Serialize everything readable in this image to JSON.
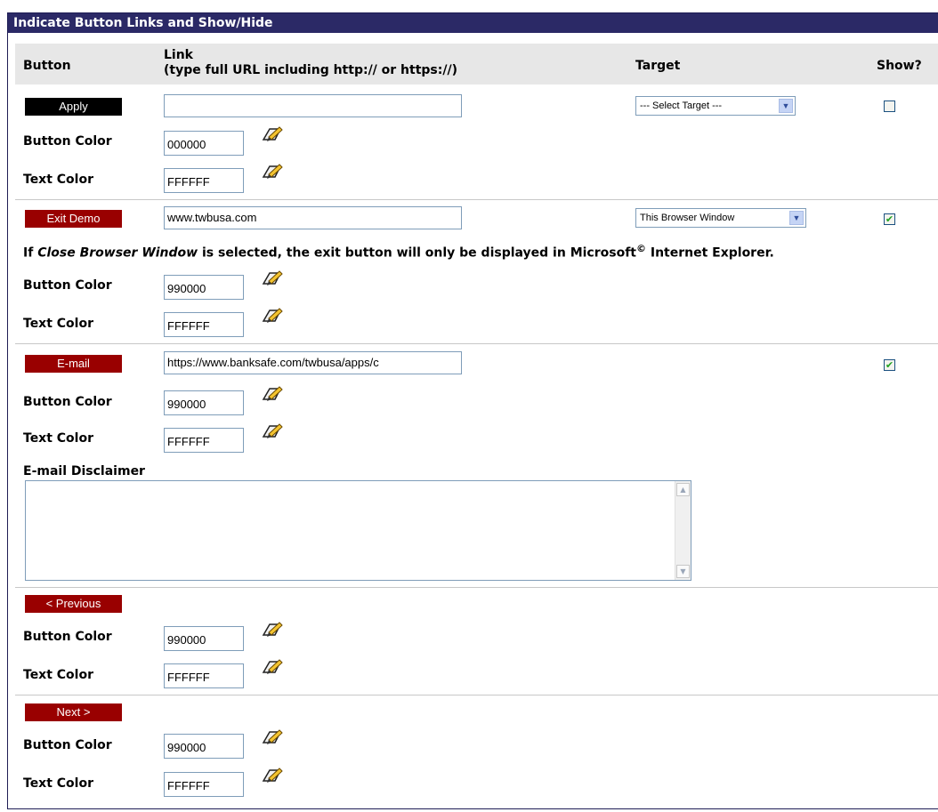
{
  "panel": {
    "title": "Indicate Button Links and Show/Hide"
  },
  "columns": {
    "button": "Button",
    "link_line1": "Link",
    "link_line2": "(type full URL including http:// or https://)",
    "target": "Target",
    "show": "Show?"
  },
  "labels": {
    "button_color": "Button Color",
    "text_color": "Text Color"
  },
  "colors": {
    "header_bg": "#2b2966",
    "check_green": "#21a121",
    "input_border": "#7f9db9"
  },
  "icons": {
    "color_picker": "color-picker-pencil-icon",
    "dropdown": "chevron-down-icon"
  },
  "buttons": {
    "apply": {
      "label": "Apply",
      "link": "",
      "target": "--- Select Target ---",
      "show": false,
      "button_color": "000000",
      "text_color": "FFFFFF"
    },
    "exit": {
      "label": "Exit Demo",
      "link": "www.twbusa.com",
      "target": "This Browser Window",
      "show": true,
      "button_color": "990000",
      "text_color": "FFFFFF"
    },
    "email": {
      "label": "E-mail",
      "link": "https://www.banksafe.com/twbusa/apps/c",
      "show": true,
      "button_color": "990000",
      "text_color": "FFFFFF"
    },
    "previous": {
      "label": "< Previous",
      "button_color": "990000",
      "text_color": "FFFFFF"
    },
    "next": {
      "label": "Next >",
      "button_color": "990000",
      "text_color": "FFFFFF"
    }
  },
  "exit_note": {
    "prefix": "If ",
    "italic": "Close Browser Window",
    "middle": " is selected, the exit button will only be displayed in Microsoft",
    "symbol": "©",
    "suffix": " Internet Explorer."
  },
  "email_disclaimer": {
    "label": "E-mail Disclaimer",
    "value": ""
  }
}
